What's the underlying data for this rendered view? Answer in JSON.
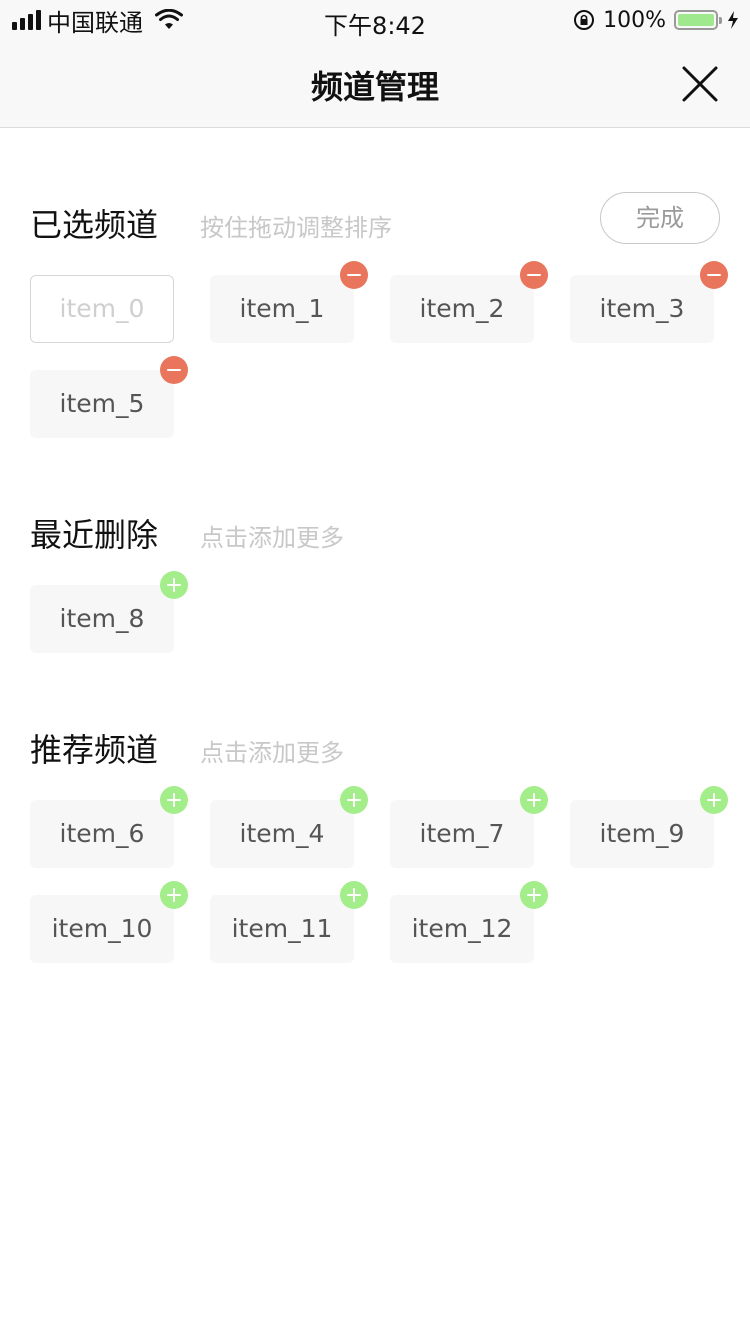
{
  "status_bar": {
    "carrier": "中国联通",
    "time": "下午8:42",
    "battery": "100%",
    "battery_level": 1.0
  },
  "nav": {
    "title": "频道管理",
    "close_icon": "close-icon"
  },
  "selected": {
    "title": "已选频道",
    "hint": "按住拖动调整排序",
    "done_label": "完成",
    "items": [
      "item_0",
      "item_1",
      "item_2",
      "item_3",
      "item_5"
    ]
  },
  "recent": {
    "title": "最近删除",
    "hint": "点击添加更多",
    "items": [
      "item_8"
    ]
  },
  "recommended": {
    "title": "推荐频道",
    "hint": "点击添加更多",
    "items": [
      "item_6",
      "item_4",
      "item_7",
      "item_9",
      "item_10",
      "item_11",
      "item_12"
    ]
  },
  "colors": {
    "remove_badge": "#e8755c",
    "add_badge": "#a3ee8a",
    "chip_bg": "#f7f7f7"
  }
}
